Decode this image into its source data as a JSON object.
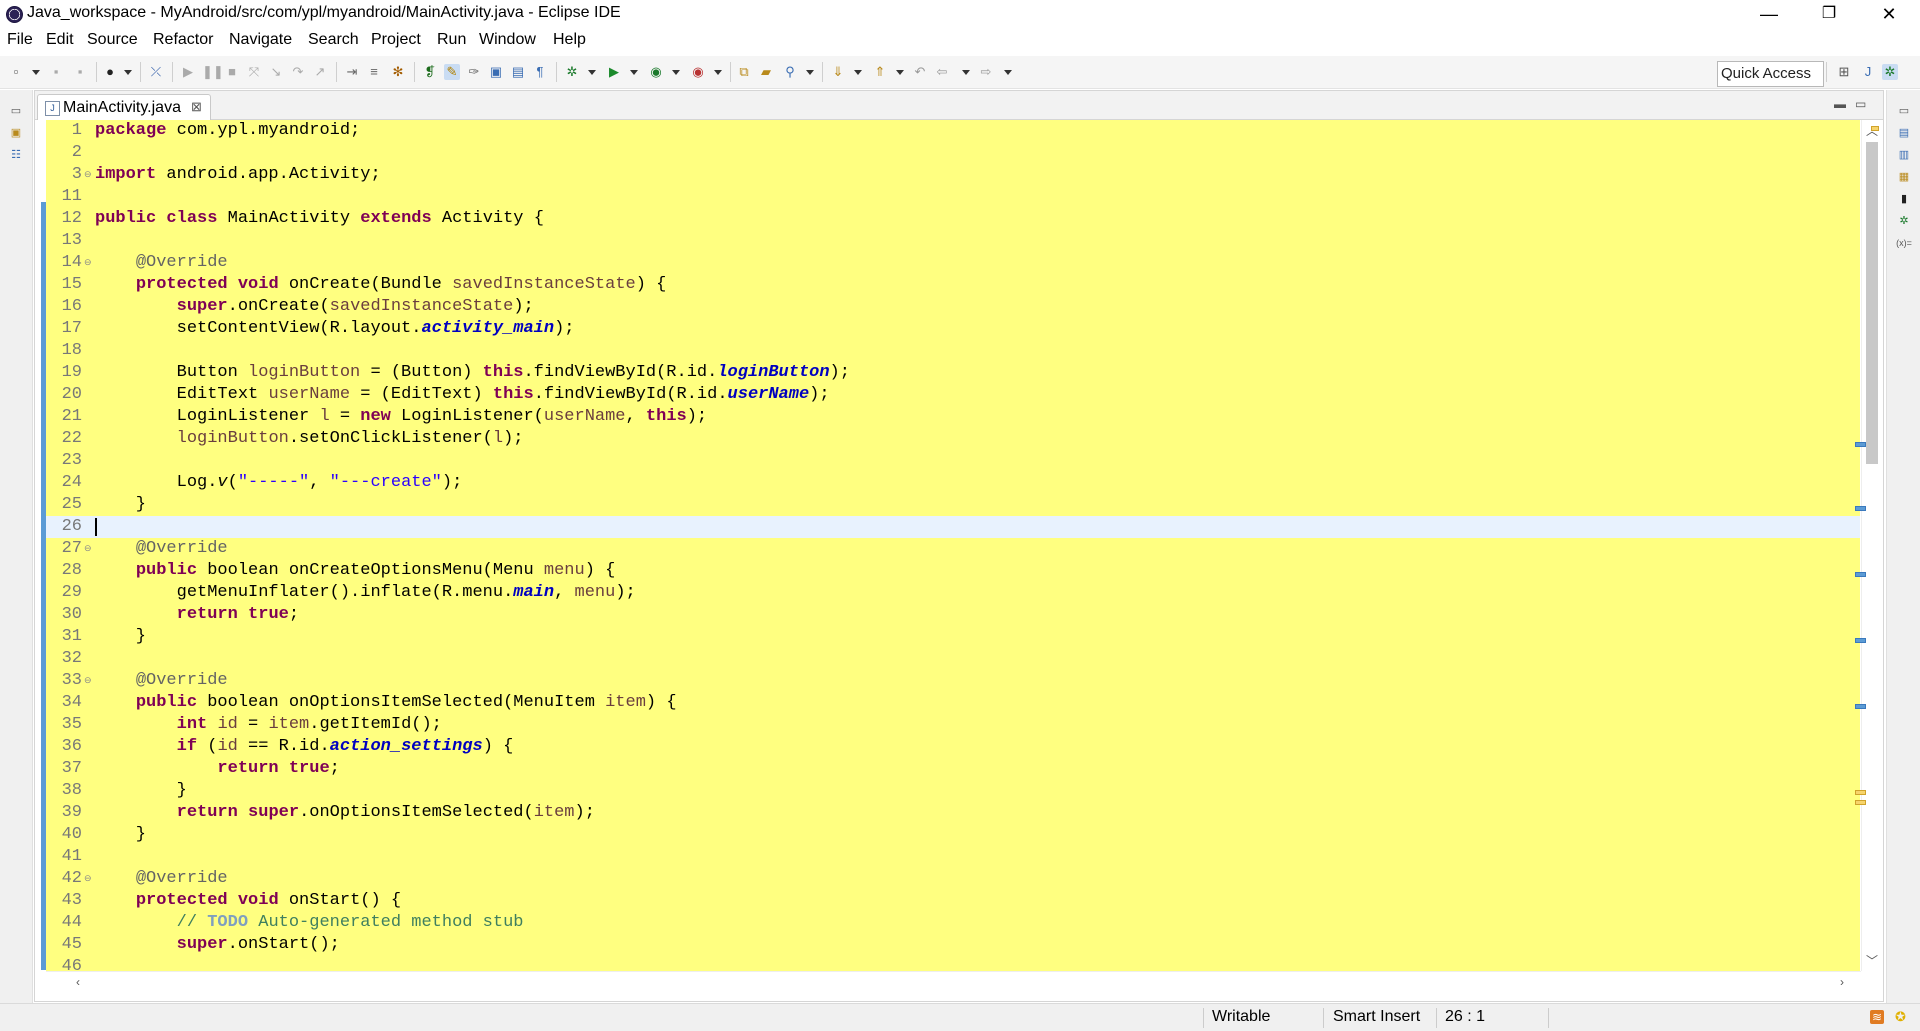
{
  "window": {
    "title": "Java_workspace - MyAndroid/src/com/ypl/myandroid/MainActivity.java - Eclipse IDE",
    "minimize": "—",
    "restore": "❐",
    "close": "✕"
  },
  "menu": [
    "File",
    "Edit",
    "Source",
    "Refactor",
    "Navigate",
    "Search",
    "Project",
    "Run",
    "Window",
    "Help"
  ],
  "toolbar": {
    "quick_access": "Quick Access"
  },
  "editor": {
    "tab_label": "MainActivity.java",
    "tab_close": "⊠",
    "current_line": 26,
    "lines": [
      {
        "n": "1",
        "t": "package com.ypl.myandroid;"
      },
      {
        "n": "2",
        "t": ""
      },
      {
        "n": "3",
        "t": "import android.app.Activity;"
      },
      {
        "n": "11",
        "t": ""
      },
      {
        "n": "12",
        "t": "public class MainActivity extends Activity {"
      },
      {
        "n": "13",
        "t": ""
      },
      {
        "n": "14",
        "t": "    @Override"
      },
      {
        "n": "15",
        "t": "    protected void onCreate(Bundle savedInstanceState) {"
      },
      {
        "n": "16",
        "t": "        super.onCreate(savedInstanceState);"
      },
      {
        "n": "17",
        "t": "        setContentView(R.layout.activity_main);"
      },
      {
        "n": "18",
        "t": ""
      },
      {
        "n": "19",
        "t": "        Button loginButton = (Button) this.findViewById(R.id.loginButton);"
      },
      {
        "n": "20",
        "t": "        EditText userName = (EditText) this.findViewById(R.id.userName);"
      },
      {
        "n": "21",
        "t": "        LoginListener l = new LoginListener(userName, this);"
      },
      {
        "n": "22",
        "t": "        loginButton.setOnClickListener(l);"
      },
      {
        "n": "23",
        "t": ""
      },
      {
        "n": "24",
        "t": "        Log.v(\"-----\", \"---create\");"
      },
      {
        "n": "25",
        "t": "    }"
      },
      {
        "n": "26",
        "t": ""
      },
      {
        "n": "27",
        "t": "    @Override"
      },
      {
        "n": "28",
        "t": "    public boolean onCreateOptionsMenu(Menu menu) {"
      },
      {
        "n": "29",
        "t": "        getMenuInflater().inflate(R.menu.main, menu);"
      },
      {
        "n": "30",
        "t": "        return true;"
      },
      {
        "n": "31",
        "t": "    }"
      },
      {
        "n": "32",
        "t": ""
      },
      {
        "n": "33",
        "t": "    @Override"
      },
      {
        "n": "34",
        "t": "    public boolean onOptionsItemSelected(MenuItem item) {"
      },
      {
        "n": "35",
        "t": "        int id = item.getItemId();"
      },
      {
        "n": "36",
        "t": "        if (id == R.id.action_settings) {"
      },
      {
        "n": "37",
        "t": "            return true;"
      },
      {
        "n": "38",
        "t": "        }"
      },
      {
        "n": "39",
        "t": "        return super.onOptionsItemSelected(item);"
      },
      {
        "n": "40",
        "t": "    }"
      },
      {
        "n": "41",
        "t": ""
      },
      {
        "n": "42",
        "t": "    @Override"
      },
      {
        "n": "43",
        "t": "    protected void onStart() {"
      },
      {
        "n": "44",
        "t": "        // TODO Auto-generated method stub"
      },
      {
        "n": "45",
        "t": "        super.onStart();"
      },
      {
        "n": "46",
        "t": ""
      }
    ],
    "colors": {
      "background": "#ffff80",
      "current_line": "#e8f2fe",
      "keyword": "#7f0055",
      "field": "#0000c0",
      "string": "#2a00ff",
      "comment": "#3f7f5f"
    }
  },
  "status": {
    "mode": "Writable",
    "insert": "Smart Insert",
    "position": "26 : 1"
  }
}
